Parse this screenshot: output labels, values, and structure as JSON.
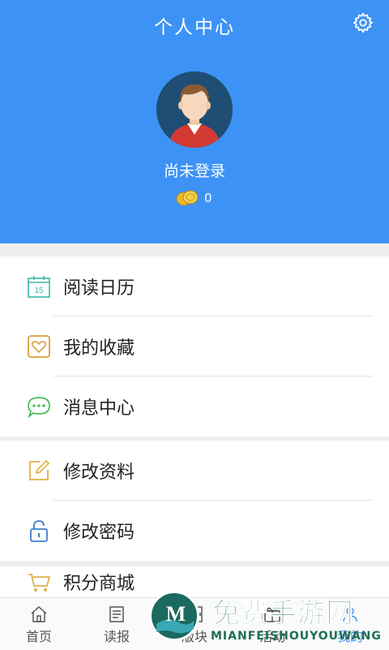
{
  "header": {
    "title": "个人中心",
    "login_status": "尚未登录",
    "coin_count": "0",
    "bg_color": "#3d93f5"
  },
  "menu_group_1": [
    {
      "label": "阅读日历",
      "icon": "calendar-icon",
      "icon_text": "15",
      "color": "#3cb7a7"
    },
    {
      "label": "我的收藏",
      "icon": "favorite-heart-icon",
      "color": "#d9a13c"
    },
    {
      "label": "消息中心",
      "icon": "message-bubble-icon",
      "color": "#4cbf59"
    }
  ],
  "menu_group_2": [
    {
      "label": "修改资料",
      "icon": "edit-icon",
      "color": "#e0b045"
    },
    {
      "label": "修改密码",
      "icon": "lock-icon",
      "color": "#3d7fd1"
    }
  ],
  "menu_group_3": [
    {
      "label": "积分商城",
      "icon": "shop-cart-icon",
      "color": "#e0b045"
    }
  ],
  "tabs": [
    {
      "label": "首页",
      "icon": "home-icon"
    },
    {
      "label": "读报",
      "icon": "newspaper-icon"
    },
    {
      "label": "版块",
      "icon": "section-icon"
    },
    {
      "label": "活动",
      "icon": "activity-icon"
    },
    {
      "label": "我的",
      "icon": "user-icon",
      "active": true
    }
  ],
  "watermark": {
    "text_cn": "免费手游网",
    "text_en": "MIANFEISHOUYOUWANG",
    "letter": "M"
  }
}
